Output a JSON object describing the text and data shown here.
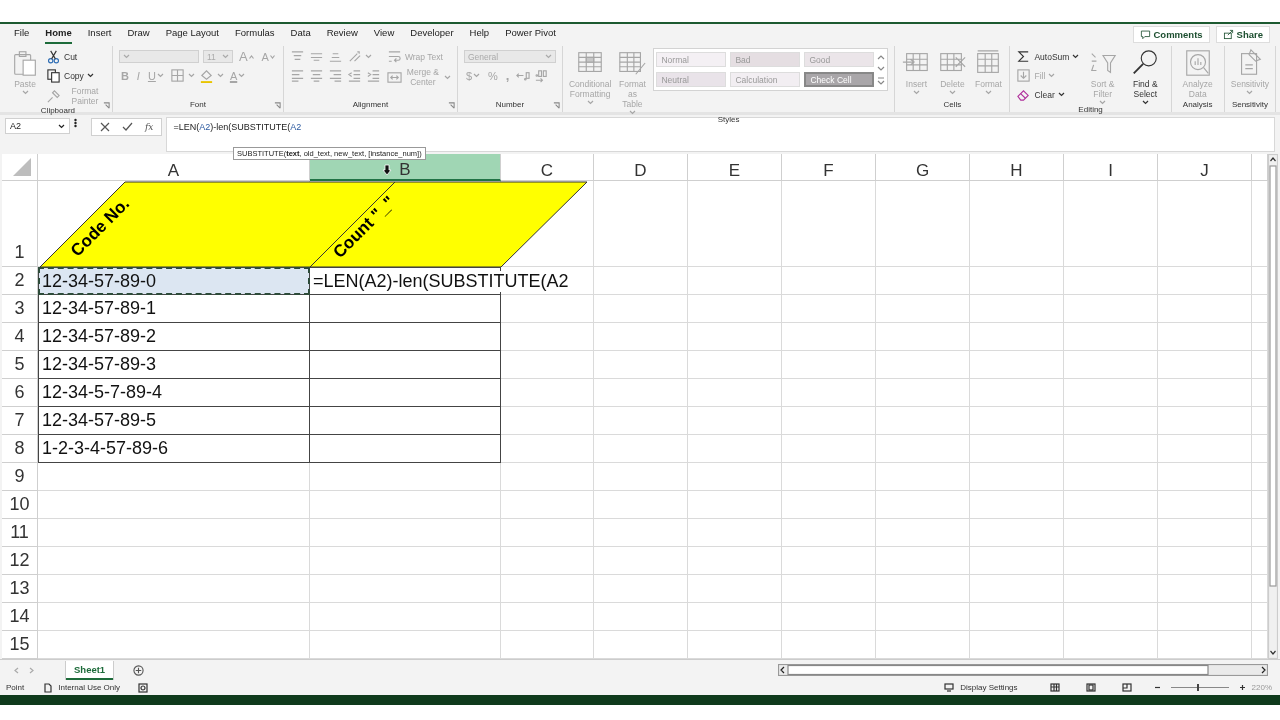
{
  "ribbon_tabs": [
    {
      "label": "File",
      "selected": false
    },
    {
      "label": "Home",
      "selected": true
    },
    {
      "label": "Insert",
      "selected": false
    },
    {
      "label": "Draw",
      "selected": false
    },
    {
      "label": "Page Layout",
      "selected": false
    },
    {
      "label": "Formulas",
      "selected": false
    },
    {
      "label": "Data",
      "selected": false
    },
    {
      "label": "Review",
      "selected": false
    },
    {
      "label": "View",
      "selected": false
    },
    {
      "label": "Developer",
      "selected": false
    },
    {
      "label": "Help",
      "selected": false
    },
    {
      "label": "Power Pivot",
      "selected": false
    }
  ],
  "ribbon_actions": [
    {
      "label": "Comments"
    },
    {
      "label": "Share"
    }
  ],
  "ribbon_groups": [
    {
      "label": "Clipboard",
      "launcher": true,
      "columns": [
        [
          [
            {
              "kind": "large",
              "label": "Paste",
              "disabled": true,
              "menu": true
            }
          ]
        ],
        [
          [
            {
              "kind": "small",
              "label": "Cut",
              "disabled": false
            }
          ],
          [
            {
              "kind": "small",
              "label": "Copy",
              "disabled": false,
              "menu": true
            }
          ],
          [
            {
              "kind": "small",
              "label": "Format Painter",
              "disabled": true
            }
          ]
        ]
      ]
    },
    {
      "label": "Font",
      "launcher": true,
      "columns": [
        [
          [
            {
              "kind": "font-name",
              "disabled": true
            },
            {
              "kind": "font-size",
              "value": "11",
              "disabled": true
            },
            {
              "kind": "grow-font",
              "label": "A",
              "disabled": true
            },
            {
              "kind": "shrink-font",
              "label": "A",
              "disabled": true
            }
          ],
          [
            {
              "kind": "bold",
              "label": "B",
              "disabled": true
            },
            {
              "kind": "italic",
              "label": "I",
              "disabled": true
            },
            {
              "kind": "underline",
              "label": "U",
              "disabled": true,
              "menu": true
            },
            {
              "kind": "icon",
              "disabled": true,
              "menu": true
            },
            {
              "kind": "icon",
              "disabled": true,
              "menu": true
            },
            {
              "kind": "font-color",
              "label": "A",
              "disabled": true,
              "menu": true
            }
          ]
        ]
      ]
    },
    {
      "label": "Alignment",
      "launcher": true,
      "columns": [
        [
          [
            {
              "kind": "icon",
              "disabled": true
            },
            {
              "kind": "icon",
              "disabled": true
            },
            {
              "kind": "icon",
              "disabled": true
            },
            {
              "kind": "icon",
              "disabled": true,
              "menu": true
            }
          ],
          [
            {
              "kind": "icon",
              "disabled": true
            },
            {
              "kind": "icon",
              "disabled": true
            },
            {
              "kind": "icon",
              "disabled": true
            },
            {
              "kind": "icon",
              "disabled": true
            },
            {
              "kind": "icon",
              "disabled": true
            }
          ]
        ],
        [
          [
            {
              "kind": "small",
              "label": "Wrap Text",
              "disabled": true
            }
          ],
          [
            {
              "kind": "small",
              "label": "Merge & Center",
              "disabled": true,
              "menu": true
            }
          ]
        ]
      ]
    },
    {
      "label": "Number",
      "launcher": true,
      "columns": [
        [
          [
            {
              "kind": "number-format",
              "value": "General",
              "disabled": true
            }
          ],
          [
            {
              "kind": "currency",
              "label": "$",
              "disabled": true,
              "menu": true
            },
            {
              "kind": "percent",
              "label": "%",
              "disabled": true
            },
            {
              "kind": "comma-style",
              "label": ",",
              "disabled": true
            },
            {
              "kind": "icon",
              "disabled": true
            },
            {
              "kind": "icon",
              "disabled": true
            }
          ]
        ]
      ]
    },
    {
      "label": "Styles",
      "columns": [
        [
          [
            {
              "kind": "large",
              "label": "Conditional Formatting",
              "disabled": true,
              "menu": true
            }
          ]
        ],
        [
          [
            {
              "kind": "large",
              "label": "Format as Table",
              "disabled": true,
              "menu": true
            }
          ]
        ],
        [
          [
            {
              "kind": "style",
              "label": "Normal",
              "color": "#f4f0f4"
            },
            {
              "kind": "style",
              "label": "Bad",
              "color": "#e5dee2"
            },
            {
              "kind": "style",
              "label": "Good",
              "color": "#ebe5e9"
            }
          ],
          [
            {
              "kind": "style",
              "label": "Neutral",
              "color": "#e9e3e9"
            },
            {
              "kind": "style",
              "label": "Calculation",
              "color": "#f2eef2"
            },
            {
              "kind": "style",
              "label": "Check Cell",
              "color": "#a9a6a9"
            }
          ]
        ]
      ]
    },
    {
      "label": "Cells",
      "columns": [
        [
          [
            {
              "kind": "large",
              "label": "Insert",
              "disabled": true,
              "menu": true
            }
          ]
        ],
        [
          [
            {
              "kind": "large",
              "label": "Delete",
              "disabled": true,
              "menu": true
            }
          ]
        ],
        [
          [
            {
              "kind": "large",
              "label": "Format",
              "disabled": true,
              "menu": true
            }
          ]
        ]
      ]
    },
    {
      "label": "Editing",
      "columns": [
        [
          [
            {
              "kind": "small",
              "label": "AutoSum",
              "disabled": false,
              "menu": true
            }
          ],
          [
            {
              "kind": "small",
              "label": "Fill",
              "disabled": true,
              "menu": true
            }
          ],
          [
            {
              "kind": "small",
              "label": "Clear",
              "disabled": false,
              "menu": true
            }
          ]
        ],
        [
          [
            {
              "kind": "large",
              "label": "Sort & Filter",
              "disabled": true,
              "menu": true
            }
          ]
        ],
        [
          [
            {
              "kind": "large",
              "label": "Find & Select",
              "disabled": false,
              "menu": true
            }
          ]
        ]
      ]
    },
    {
      "label": "Analysis",
      "columns": [
        [
          [
            {
              "kind": "large",
              "label": "Analyze Data",
              "disabled": true
            }
          ]
        ]
      ]
    },
    {
      "label": "Sensitivity",
      "columns": [
        [
          [
            {
              "kind": "large",
              "label": "Sensitivity",
              "disabled": true,
              "menu": true
            }
          ]
        ]
      ]
    }
  ],
  "formula_bar": {
    "name_box": "A2",
    "function_button": "fx",
    "formula_parts": [
      {
        "text": "=LEN(",
        "ref": false
      },
      {
        "text": "A2",
        "ref": true
      },
      {
        "text": ")-len(SUBSTITUTE(",
        "ref": false
      },
      {
        "text": "A2",
        "ref": true
      }
    ]
  },
  "tooltip": "SUBSTITUTE(**text**, old_text, new_text, [instance_num])",
  "sheet": {
    "columns": [
      {
        "label": "A",
        "selected": false
      },
      {
        "label": "B",
        "selected": true
      },
      {
        "label": "C",
        "selected": false
      },
      {
        "label": "D",
        "selected": false
      },
      {
        "label": "E",
        "selected": false
      },
      {
        "label": "F",
        "selected": false
      },
      {
        "label": "G",
        "selected": false
      },
      {
        "label": "H",
        "selected": false
      },
      {
        "label": "I",
        "selected": false
      },
      {
        "label": "J",
        "selected": false
      }
    ],
    "headers": [
      "Code No.",
      "Count \"_\""
    ],
    "rows": [
      {
        "label": "1",
        "kind": "header"
      },
      {
        "label": "2",
        "kind": "data",
        "code": "12-34-57-89-0",
        "referenced": true,
        "formula": "=LEN(A2)-len(SUBSTITUTE(A2"
      },
      {
        "label": "3",
        "kind": "data",
        "code": "12-34-57-89-1",
        "referenced": false
      },
      {
        "label": "4",
        "kind": "data",
        "code": "12-34-57-89-2",
        "referenced": false
      },
      {
        "label": "5",
        "kind": "data",
        "code": "12-34-57-89-3",
        "referenced": false
      },
      {
        "label": "6",
        "kind": "data",
        "code": "12-34-5-7-89-4",
        "referenced": false
      },
      {
        "label": "7",
        "kind": "data",
        "code": "12-34-57-89-5",
        "referenced": false
      },
      {
        "label": "8",
        "kind": "data",
        "code": "1-2-3-4-57-89-6",
        "referenced": false
      },
      {
        "label": "9",
        "kind": "data"
      },
      {
        "label": "10",
        "kind": "data"
      },
      {
        "label": "11",
        "kind": "data"
      },
      {
        "label": "12",
        "kind": "data"
      },
      {
        "label": "13",
        "kind": "data"
      },
      {
        "label": "14",
        "kind": "data"
      },
      {
        "label": "15",
        "kind": "data"
      }
    ]
  },
  "sheet_tabs": [
    {
      "label": "Sheet1",
      "selected": true
    }
  ],
  "status_bar": {
    "mode": "Point",
    "sensitivity_label": "Internal Use Only",
    "display_settings": "Display Settings",
    "zoom": {
      "level": 0.45,
      "reading": "220%"
    }
  }
}
